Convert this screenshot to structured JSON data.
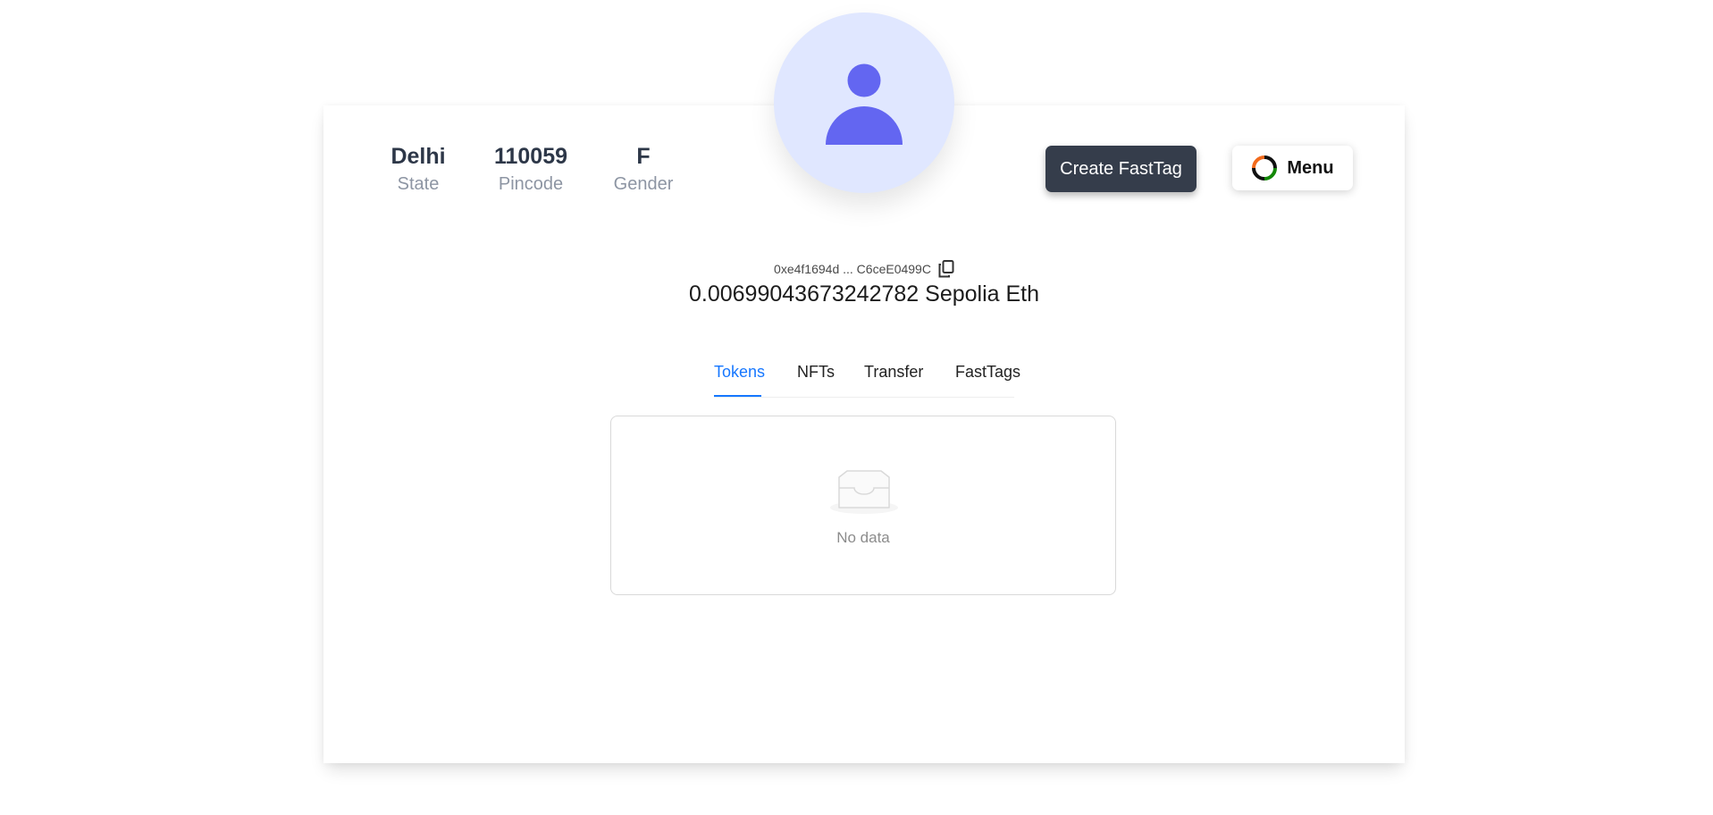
{
  "profile": {
    "stats": [
      {
        "value": "Delhi",
        "label": "State"
      },
      {
        "value": "110059",
        "label": "Pincode"
      },
      {
        "value": "F",
        "label": "Gender"
      }
    ],
    "avatar_icon": "user-icon",
    "avatar_bg": "#e0e7ff",
    "avatar_fg": "#6366f1"
  },
  "actions": {
    "create_label": "Create FastTag",
    "menu_label": "Menu",
    "menu_icon": "tricolor-circle-icon"
  },
  "wallet": {
    "address": "0xe4f1694d ... C6ceE0499C",
    "copy_icon": "copy-icon",
    "balance": "0.00699043673242782 Sepolia Eth"
  },
  "tabs": {
    "items": [
      "Tokens",
      "NFTs",
      "Transfer",
      "FastTags"
    ],
    "active": "Tokens",
    "accent": "#1677ff"
  },
  "tokens_panel": {
    "empty_text": "No data",
    "empty_icon": "inbox-icon"
  }
}
